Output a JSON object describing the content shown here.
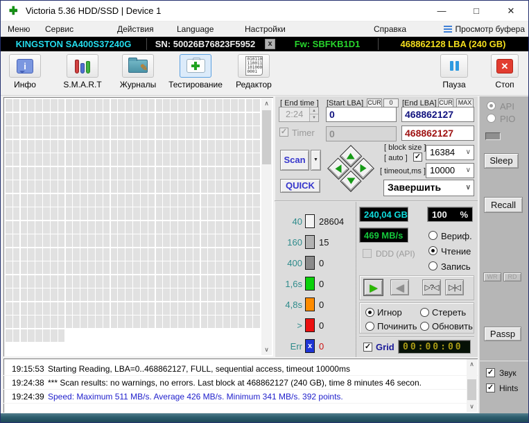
{
  "window": {
    "title": "Victoria 5.36 HDD/SSD | Device 1",
    "minimize": "—",
    "maximize": "□",
    "close": "✕"
  },
  "menu": {
    "items": [
      "Меню",
      "Сервис",
      "Действия",
      "Language",
      "Настройки",
      "Справка"
    ],
    "buffer_view": "Просмотр буфера"
  },
  "device_bar": {
    "model": "KINGSTON SA400S37240G",
    "serial": "SN: 50026B76823F5952",
    "close_badge": "x",
    "firmware": "Fw: SBFKB1D1",
    "capacity": "468862128 LBA (240 GB)"
  },
  "toolbar": {
    "info": "Инфо",
    "smart": "S.M.A.R.T",
    "logs": "Журналы",
    "testing": "Тестирование",
    "editor": "Редактор",
    "pause": "Пауза",
    "stop": "Стоп",
    "editor_icon_lines": [
      "010110",
      "110011",
      "101000",
      "0001"
    ]
  },
  "test_panel": {
    "end_time_label": "[ End time ]",
    "end_time_value": "2:24",
    "start_lba_label": "[Start LBA]",
    "end_lba_label": "[End LBA]",
    "cur_button": "CUR",
    "zero_button": "0",
    "max_button": "MAX",
    "start_lba_value": "0",
    "end_lba_value": "468862127",
    "timer_label": "Timer",
    "timer_lba_value": "0",
    "current_lba_value": "468862127",
    "scan_button": "Scan",
    "quick_button": "QUICK",
    "block_size_label": "[ block size ]",
    "auto_label": "[ auto ]",
    "block_size_value": "16384",
    "timeout_label": "[ timeout,ms ]",
    "timeout_value": "10000",
    "on_finish_value": "Завершить"
  },
  "stats": [
    {
      "label": "40",
      "color": "#f4f4f4",
      "count": "28604"
    },
    {
      "label": "160",
      "color": "#b2b2b2",
      "count": "15"
    },
    {
      "label": "400",
      "color": "#8a8a8a",
      "count": "0"
    },
    {
      "label": "1,6s",
      "color": "#0ad10a",
      "count": "0"
    },
    {
      "label": "4,8s",
      "color": "#ff8c00",
      "count": "0"
    },
    {
      "label": ">",
      "color": "#ea1010",
      "count": "0"
    },
    {
      "label": "Err",
      "color": "#1f35d4",
      "count": "0",
      "glyph": "x",
      "count_color": "#cc1111"
    }
  ],
  "displays": {
    "capacity": "240,04 GB",
    "progress_value": "100",
    "progress_unit": "%",
    "speed": "469 MB/s",
    "elapsed": "00:00:00"
  },
  "mode": {
    "ddd_label": "DDD (API)",
    "verify": "Вериф.",
    "read": "Чтение",
    "write": "Запись"
  },
  "playback": {
    "play": "▶",
    "back": "◀",
    "skip_question": "▷?◁",
    "skip_end": "▷|◁"
  },
  "defect_actions": {
    "ignore": "Игнор",
    "erase": "Стереть",
    "repair": "Починить",
    "refresh": "Обновить"
  },
  "grid_label": "Grid",
  "sidebar": {
    "api": "API",
    "pio": "PIO",
    "sleep": "Sleep",
    "recall": "Recall",
    "wr": "WR",
    "rd": "RD",
    "passp": "Passp",
    "sound": "Звук",
    "hints": "Hints"
  },
  "log": {
    "entries": [
      {
        "time": "19:15:53",
        "text": "Starting Reading, LBA=0..468862127, FULL, sequential access, timeout 10000ms",
        "color": "black"
      },
      {
        "time": "19:24:38",
        "text": "*** Scan results: no warnings, no errors. Last block at 468862127 (240 GB), time 8 minutes 46 secon.",
        "color": "black"
      },
      {
        "time": "19:24:39",
        "text": "Speed: Maximum 511 MB/s. Average 426 MB/s. Minimum 341 MB/s. 392 points.",
        "color": "blue"
      }
    ]
  },
  "scan_map": {
    "rows": 17,
    "cols": 34,
    "partial_cells": 8,
    "cell_color": "#e1e1e1"
  }
}
